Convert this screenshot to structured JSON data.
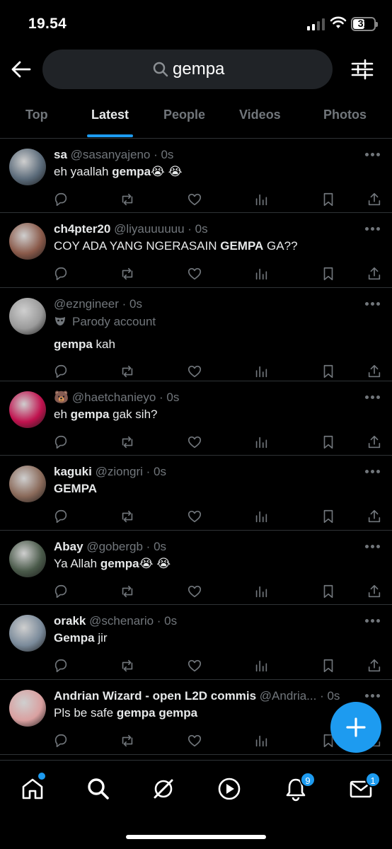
{
  "status": {
    "time": "19.54",
    "battery": "31"
  },
  "search": {
    "query": "gempa"
  },
  "tabs": [
    "Top",
    "Latest",
    "People",
    "Videos",
    "Photos"
  ],
  "active_tab": "Latest",
  "tweets": [
    {
      "name": "sa",
      "handle": "@sasanyajeno · 0s",
      "parts": [
        {
          "t": "eh yaallah "
        },
        {
          "t": "gempa",
          "b": true
        },
        {
          "t": "😭 😭"
        }
      ],
      "avatar_color": "#5b6b7a"
    },
    {
      "name": "ch4pter20",
      "handle": "@liyauuuuuu · 0s",
      "parts": [
        {
          "t": "COY ADA YANG NGERASAIN "
        },
        {
          "t": "GEMPA",
          "b": true
        },
        {
          "t": " GA??"
        }
      ],
      "avatar_color": "#8a5a4a"
    },
    {
      "name": "",
      "handle": "@ezngineer · 0s",
      "parody": "Parody account",
      "parts": [
        {
          "t": "gempa",
          "b": true
        },
        {
          "t": " kah"
        }
      ],
      "avatar_color": "#9a9a9a"
    },
    {
      "name": "🐻",
      "handle": "@haetchanieyo · 0s",
      "parts": [
        {
          "t": "eh "
        },
        {
          "t": "gempa",
          "b": true
        },
        {
          "t": " gak sih?"
        }
      ],
      "avatar_color": "#c0124e"
    },
    {
      "name": "kaguki",
      "handle": "@ziongri · 0s",
      "parts": [
        {
          "t": "GEMPA",
          "b": true
        }
      ],
      "avatar_color": "#8a6a5a"
    },
    {
      "name": "Abay",
      "handle": "@gobergb · 0s",
      "parts": [
        {
          "t": "Ya Allah "
        },
        {
          "t": "gempa",
          "b": true
        },
        {
          "t": "😭 😭"
        }
      ],
      "avatar_color": "#4a5a4a"
    },
    {
      "name": "orakk",
      "handle": "@schenario · 0s",
      "parts": [
        {
          "t": "Gempa",
          "b": true
        },
        {
          "t": " jir"
        }
      ],
      "avatar_color": "#7a8a9a"
    },
    {
      "name": "Andrian Wizard - open L2D commis",
      "handle": "@Andria... · 0s",
      "parts": [
        {
          "t": "Pls be safe "
        },
        {
          "t": "gempa gempa",
          "b": true
        }
      ],
      "avatar_color": "#d9a0a0"
    }
  ],
  "nav": {
    "notifications_count": "9",
    "messages_count": "1"
  },
  "colors": {
    "accent": "#1d9bf0",
    "muted": "#71767b",
    "divider": "#2f3336",
    "background": "#000000"
  }
}
